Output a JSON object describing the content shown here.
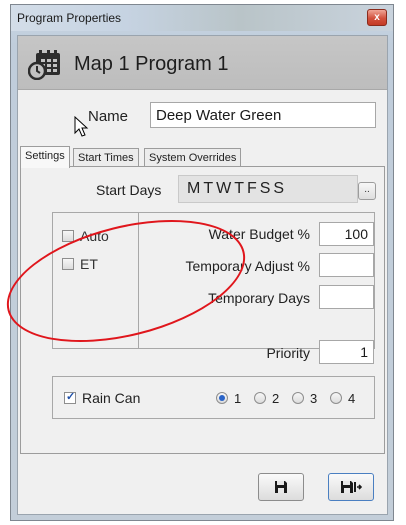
{
  "window": {
    "title": "Program Properties",
    "close_glyph": "x"
  },
  "header": {
    "title": "Map 1 Program 1",
    "icon": "calendar-clock-icon"
  },
  "name": {
    "label": "Name",
    "value": "Deep Water Green"
  },
  "tabs": [
    {
      "label": "Settings",
      "active": true
    },
    {
      "label": "Start Times",
      "active": false
    },
    {
      "label": "System Overrides",
      "active": false
    }
  ],
  "settings": {
    "start_days_label": "Start Days",
    "start_days_value": "MTWTFSS",
    "ellipsis_label": "..",
    "mode_options": [
      {
        "label": "Auto",
        "checked": false
      },
      {
        "label": "ET",
        "checked": false
      }
    ],
    "water_budget": {
      "label": "Water Budget %",
      "value": "100"
    },
    "temporary_adjust": {
      "label": "Temporary Adjust %",
      "value": ""
    },
    "temporary_days": {
      "label": "Temporary Days",
      "value": ""
    },
    "priority": {
      "label": "Priority",
      "value": "1"
    },
    "rain_can": {
      "label": "Rain Can",
      "checked": true,
      "options": [
        "1",
        "2",
        "3",
        "4"
      ],
      "selected": "1"
    }
  },
  "buttons": {
    "save_icon": "save-icon",
    "save_close_icon": "save-and-close-icon"
  },
  "colors": {
    "annotation": "#e0161c",
    "header_band": "#c2c2c2",
    "checkbox_check": "#1e4fa8"
  }
}
